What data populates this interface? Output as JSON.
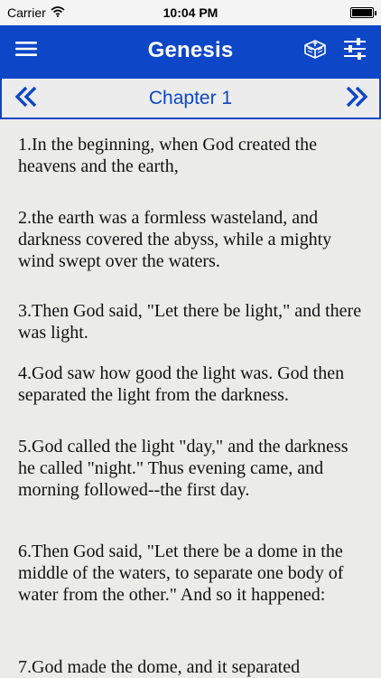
{
  "status_bar": {
    "carrier": "Carrier",
    "time": "10:04 PM",
    "battery_level": 1.0
  },
  "nav": {
    "title": "Genesis",
    "icons": [
      "menu-icon",
      "bible-book-icon",
      "settings-sliders-icon"
    ]
  },
  "chapter_nav": {
    "title": "Chapter 1",
    "prev_icon": "double-chevron-left-icon",
    "next_icon": "double-chevron-right-icon"
  },
  "verses": [
    "1.In the beginning, when God created the heavens and the earth,",
    "2.the earth was a formless wasteland, and darkness covered the abyss, while a mighty wind swept over the waters.",
    "3.Then God said, \"Let there be light,\" and there was light.",
    "4.God saw how good the light was. God then separated the light from the darkness.",
    "5.God called the light \"day,\" and the darkness he called \"night.\" Thus evening came, and morning followed--the first day.",
    "6.Then God said, \"Let there be a dome in the middle of the waters, to separate one body of water from the other.\" And so it happened:",
    "7.God made the dome, and it separated"
  ],
  "colors": {
    "nav_background": "#0d47c7",
    "accent": "#0d47c7",
    "page_background": "#ebebe8",
    "text": "#111111"
  }
}
